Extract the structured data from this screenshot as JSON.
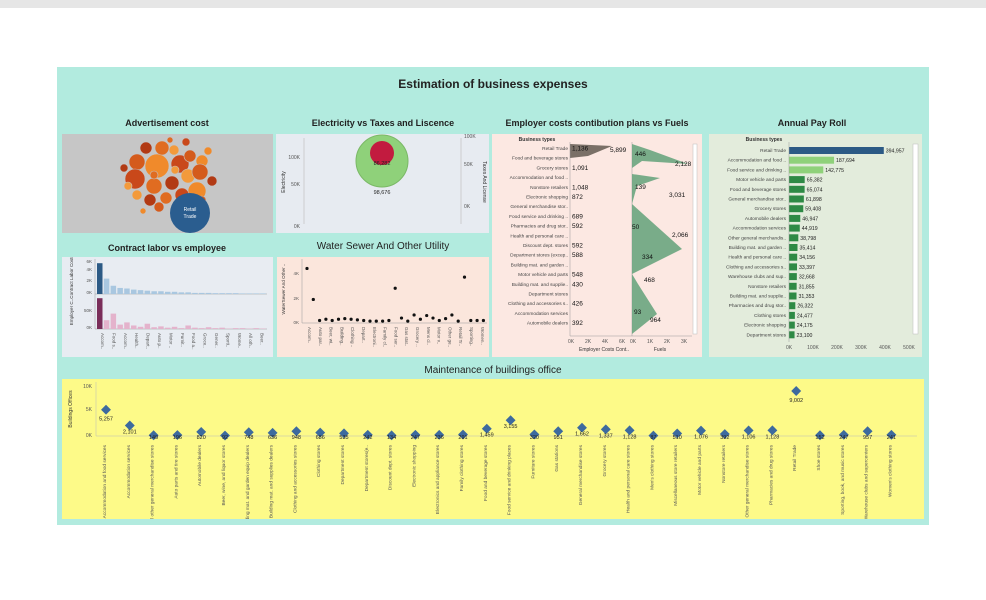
{
  "dashboard_title": "Estimation of business expenses",
  "panels": {
    "advertisement": {
      "title": "Advertisement cost",
      "largest_label": "Retail Trade"
    },
    "electricity": {
      "title": "Electricity vs Taxes and Liscence",
      "y_left_label": "Electricity",
      "y_right_label": "Taxes And License",
      "left_ticks": [
        "100K",
        "50K",
        "0K"
      ],
      "right_ticks": [
        "100K",
        "50K",
        "0K"
      ],
      "inner_value": "86,282",
      "outer_value": "98,676"
    },
    "employer": {
      "title": "Employer costs contibution plans vs Fuels",
      "header": "Business types",
      "x1_title": "Employer Costs Cont..",
      "x2_title": "Fuels",
      "x1_ticks": [
        "0K",
        "2K",
        "4K",
        "6K"
      ],
      "x2_ticks": [
        "0K",
        "1K",
        "2K",
        "3K"
      ]
    },
    "payroll": {
      "title": "Annual Pay Roll",
      "header": "Business types",
      "x_ticks": [
        "0K",
        "100K",
        "200K",
        "300K",
        "400K",
        "500K"
      ]
    },
    "contract": {
      "title": "Contract labor vs employee",
      "y1_label": "Contract Labor Costs",
      "y2_label": "Employer C..",
      "y1_ticks": [
        "6K",
        "4K",
        "2K",
        "0K"
      ],
      "y2_ticks": [
        "50K",
        "0K"
      ]
    },
    "water": {
      "title": "Water Sewer And Other Utility",
      "y_label": "WaterSewer And Other ..",
      "y_ticks": [
        "4K",
        "2K",
        "0K"
      ]
    },
    "maintenance": {
      "title": "Maintenance of buildings office",
      "y_label": "Buildings Offices",
      "y_ticks": [
        "10K",
        "5K",
        "0K"
      ]
    }
  },
  "chart_data": [
    {
      "type": "scatter",
      "title": "Advertisement cost",
      "note": "packed bubbles; largest bubble Retail Trade",
      "categories": [
        "Retail Trade"
      ]
    },
    {
      "type": "scatter",
      "title": "Electricity vs Taxes and Liscence",
      "series": [
        {
          "name": "Electricity",
          "values": [
            98676
          ]
        },
        {
          "name": "Taxes And License",
          "values": [
            86282
          ]
        }
      ],
      "ylim": [
        0,
        100000
      ]
    },
    {
      "type": "bar",
      "title": "Employer costs contibution plans vs Fuels",
      "categories": [
        "Retail Trade",
        "Food and beverage stores",
        "Grocery stores",
        "Accommodation and food ..",
        "Nonstore retailers",
        "Electronic shopping",
        "General merchandise stor..",
        "Food service and drinking ..",
        "Pharmacies and drug stor..",
        "Health and personal care ..",
        "Discount dept. stores",
        "Department stores (excep..",
        "Building mat. and garden ..",
        "Motor vehicle and parts",
        "Building mat. and supplie..",
        "Department stores",
        "Clothing and accessories s..",
        "Accommodation services",
        "Automobile dealers"
      ],
      "labels_employer": {
        "Retail Trade": "1,136",
        "Grocery stores": "1,091",
        "Nonstore retailers": "1,048",
        "Electronic shopping": "872",
        "Food service and drinking ..": "689",
        "Pharmacies and drug stor..": "592",
        "Discount dept. stores": "592",
        "Department stores (excep..": "588",
        "Motor vehicle and parts": "548",
        "Building mat. and supplie..": "430",
        "Clothing and accessories s..": "426",
        "Automobile dealers": "392"
      },
      "employer_max": "5,899",
      "labels_fuels": [
        "446",
        "2,128",
        "139",
        "3,031",
        "50",
        "2,066",
        "334",
        "468",
        "93",
        "964"
      ]
    },
    {
      "type": "bar",
      "title": "Annual Pay Roll",
      "categories": [
        "Retail Trade",
        "Accommodation and food ..",
        "Food service and drinking ..",
        "Motor vehicle and parts",
        "Food and beverage stores",
        "General merchandise stor..",
        "Grocery stores",
        "Automobile dealers",
        "Accommodation services",
        "Other general merchandis..",
        "Building mat. and garden ..",
        "Health and personal care ..",
        "Clothing and accessories s..",
        "Warehouse clubs and sup..",
        "Nonstore retailers",
        "Building mat. and supplie..",
        "Pharmacies and drug stor..",
        "Clothing stores",
        "Electronic shopping",
        "Department stores"
      ],
      "values": [
        394957,
        187694,
        142775,
        65382,
        65074,
        61898,
        59408,
        46947,
        44919,
        38798,
        35414,
        34156,
        33397,
        32668,
        31855,
        31353,
        26322,
        24477,
        24175,
        23100
      ],
      "value_labels": [
        "394,957",
        "187,694",
        "142,775",
        "65,382",
        "65,074",
        "61,898",
        "59,408",
        "46,947",
        "44,919",
        "38,798",
        "35,414",
        "34,156",
        "33,397",
        "32,668",
        "31,855",
        "31,353",
        "26,322",
        "24,477",
        "24,175",
        "23,100"
      ],
      "xlim": [
        0,
        500000
      ]
    },
    {
      "type": "bar",
      "title": "Contract labor vs employee",
      "categories": [
        "Accom..",
        "Food s..",
        "Accom..",
        "Health..",
        "Depart..",
        "Auto p..",
        "Motor ..",
        "Furnit..",
        "Food a..",
        "Groce..",
        "Gener..",
        "Sporti..",
        "Wome..",
        "All oth..",
        "Beer.."
      ],
      "series": [
        {
          "name": "Contract Labor Costs",
          "values": [
            5600,
            2800,
            1500,
            1100,
            1000,
            800,
            700,
            600,
            500,
            500,
            400,
            400,
            300,
            300,
            200,
            200,
            200,
            150,
            150,
            150,
            150,
            100,
            100,
            100,
            100
          ]
        },
        {
          "name": "Employer C..",
          "values": [
            70000,
            20000,
            35000,
            10000,
            15000,
            8000,
            5000,
            12000,
            4000,
            6000,
            3000,
            5000,
            2000,
            8000,
            3000,
            2000,
            4000,
            2000,
            3000,
            1000,
            2000,
            2000,
            1000,
            2000,
            1000
          ]
        }
      ]
    },
    {
      "type": "scatter",
      "title": "Water Sewer And Other Utility",
      "categories": [
        "Accom..",
        "Auto par..",
        "Beer, wi..",
        "Building..",
        "Clothing ..",
        "Depart..",
        "Electroni..",
        "Family cl..",
        "Food ser..",
        "Gas stat..",
        "Grocery ..",
        "Mens cl..",
        "Motor v..",
        "Other ge..",
        "Retail Tr..",
        "Sporting..",
        "Women.."
      ],
      "values": [
        4400,
        1900,
        200,
        300,
        200,
        300,
        350,
        300,
        250,
        200,
        150,
        150,
        150,
        200,
        2800,
        400,
        150,
        650,
        300,
        600,
        400,
        200,
        350,
        650,
        150,
        3700,
        200,
        200,
        200
      ],
      "ylim": [
        0,
        5000
      ]
    },
    {
      "type": "scatter",
      "title": "Maintenance of buildings office",
      "categories": [
        "Accommodation and food services",
        "Accommodation services",
        "All other general merchandise stores",
        "Auto parts and tire stores",
        "Automobile dealers",
        "Beer, wine, and liquor stores",
        "Building mat. and garden equip dealers",
        "Building mat. and supplies dealers",
        "Clothing and accessories stores",
        "Clothing stores",
        "Department stores",
        "Department stores(e..",
        "Discount dept. stores",
        "Electronic shopping",
        "Electronics and appliance stores",
        "Family clothing stores",
        "Food and beverage stores",
        "Food service and drinking places",
        "Furniture stores",
        "Gas stations",
        "General merchandise stores",
        "Grocery stores",
        "Health and personal care stores",
        "Men's clothing stores",
        "Miscellaneous store retailers",
        "Motor vehicle and parts",
        "Nonstore retailers",
        "Other general merchandise stores",
        "Pharmacies and drug stores",
        "Retail Trade",
        "Shoe stores",
        "Sporting, book, and music stores",
        "Warehouse clubs and supercenters",
        "Women's clothing stores"
      ],
      "values": [
        5257,
        2101,
        149,
        196,
        820,
        92,
        748,
        636,
        948,
        686,
        535,
        242,
        134,
        247,
        236,
        291,
        1459,
        3155,
        320,
        951,
        1662,
        1337,
        1128,
        87,
        510,
        1076,
        392,
        1106,
        1128,
        9002,
        152,
        247,
        957,
        241
      ],
      "value_labels": [
        "5,257",
        "2,101",
        "149",
        "196",
        "820",
        "92",
        "748",
        "636",
        "948",
        "686",
        "535",
        "242",
        "134",
        "247",
        "236",
        "291",
        "1,459",
        "3,155",
        "320",
        "951",
        "1,662",
        "1,337",
        "1,128",
        "87",
        "510",
        "1,076",
        "392",
        "1,106",
        "1,128",
        "9,002",
        "152",
        "247",
        "957",
        "241"
      ],
      "ylim": [
        0,
        10000
      ]
    }
  ]
}
